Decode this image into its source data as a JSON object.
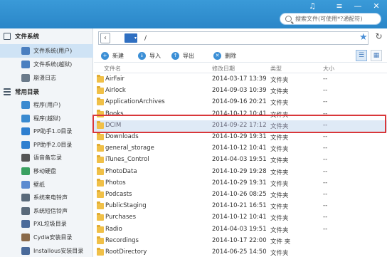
{
  "window": {
    "controls": [
      "♫",
      "≡",
      "—",
      "✕"
    ],
    "search": {
      "placeholder": "搜索文件(可使用*?通配符)"
    }
  },
  "sidebar": {
    "section1": {
      "label": "文件系统"
    },
    "fs_items": [
      {
        "label": "文件系统(用户)",
        "selected": true,
        "color": "#4a7fc0"
      },
      {
        "label": "文件系统(越狱)",
        "color": "#4a7fc0"
      },
      {
        "label": "崩溃日志",
        "color": "#6a7a8a"
      }
    ],
    "section2": {
      "label": "常用目录"
    },
    "common_items": [
      {
        "label": "程序(用户)",
        "color": "#3a8ad0"
      },
      {
        "label": "程序(越狱)",
        "color": "#3a8ad0"
      },
      {
        "label": "PP助手1.0目录",
        "color": "#2e7fd0"
      },
      {
        "label": "PP助手2.0目录",
        "color": "#2e7fd0"
      },
      {
        "label": "语音备忘录",
        "color": "#555555"
      },
      {
        "label": "移动硬盘",
        "color": "#3aa060"
      },
      {
        "label": "壁纸",
        "color": "#5a8ad0"
      },
      {
        "label": "系统来电铃声",
        "color": "#5a6a7a"
      },
      {
        "label": "系统短信铃声",
        "color": "#5a6a7a"
      },
      {
        "label": "PXL垃圾目录",
        "color": "#4a6a9a"
      },
      {
        "label": "Cydia安装目录",
        "color": "#8a6a4a"
      },
      {
        "label": "Installous安装目录",
        "color": "#4a6a9a"
      }
    ]
  },
  "addressbar": {
    "path": "/",
    "device": "▾"
  },
  "toolbar": {
    "new_label": "新建",
    "import_label": "导入",
    "export_label": "导出",
    "delete_label": "删除"
  },
  "table": {
    "headers": {
      "name": "文件名",
      "modified": "修改日期",
      "type": "类型",
      "size": "大小"
    },
    "rows": [
      {
        "name": "AirFair",
        "modified": "2014-03-17 13:39",
        "type": "文件夹",
        "size": "--"
      },
      {
        "name": "Airlock",
        "modified": "2014-09-03 10:39",
        "type": "文件夹",
        "size": "--"
      },
      {
        "name": "ApplicationArchives",
        "modified": "2014-09-16 20:21",
        "type": "文件夹",
        "size": "--"
      },
      {
        "name": "Books",
        "modified": "2014-10-12 10:41",
        "type": "文件夹",
        "size": "--"
      },
      {
        "name": "DCIM",
        "modified": "2014-09-22 17:12",
        "type": "文件夹",
        "size": "--",
        "highlighted": true
      },
      {
        "name": "Downloads",
        "modified": "2014-10-29 19:31",
        "type": "文件夹",
        "size": "--"
      },
      {
        "name": "general_storage",
        "modified": "2014-10-12 10:41",
        "type": "文件夹",
        "size": "--"
      },
      {
        "name": "iTunes_Control",
        "modified": "2014-04-03 19:51",
        "type": "文件夹",
        "size": "--"
      },
      {
        "name": "PhotoData",
        "modified": "2014-10-29 19:28",
        "type": "文件夹",
        "size": "--"
      },
      {
        "name": "Photos",
        "modified": "2014-10-29 19:31",
        "type": "文件夹",
        "size": "--"
      },
      {
        "name": "Podcasts",
        "modified": "2014-10-26 08:25",
        "type": "文件夹",
        "size": "--"
      },
      {
        "name": "PublicStaging",
        "modified": "2014-10-21 16:51",
        "type": "文件夹",
        "size": "--"
      },
      {
        "name": "Purchases",
        "modified": "2014-10-12 10:41",
        "type": "文件夹",
        "size": "--"
      },
      {
        "name": "Radio",
        "modified": "2014-04-03 19:51",
        "type": "文件夹",
        "size": "--"
      },
      {
        "name": "Recordings",
        "modified": "2014-10-17 22:00",
        "type": "文件 夹",
        "size": ""
      },
      {
        "name": "RootDirectory",
        "modified": "2014-06-25 14:50",
        "type": "文件夹",
        "size": ""
      }
    ]
  },
  "colors": {
    "accent": "#2a86c8",
    "highlight_border": "#d9373a",
    "folder": "#f0c048"
  }
}
